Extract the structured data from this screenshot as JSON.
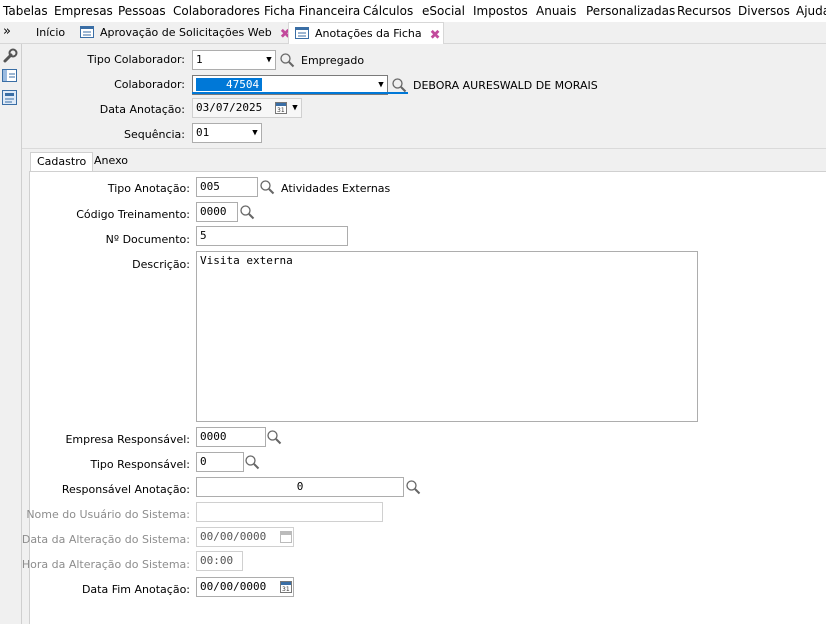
{
  "menu": [
    "Tabelas",
    "Empresas",
    "Pessoas",
    "Colaboradores",
    "Ficha Financeira",
    "Cálculos",
    "eSocial",
    "Impostos",
    "Anuais",
    "Personalizadas",
    "Recursos",
    "Diversos",
    "Ajuda"
  ],
  "tabs": {
    "chevron": "»",
    "inicio": "Início",
    "aprovacao": "Aprovação de Solicitações Web",
    "anotacoes": "Anotações da Ficha",
    "close_glyph": "✖"
  },
  "header": {
    "tipo_colaborador": {
      "label": "Tipo Colaborador:",
      "value": "1",
      "desc": "Empregado"
    },
    "colaborador": {
      "label": "Colaborador:",
      "value": "47504",
      "desc": "DEBORA AURESWALD DE MORAIS"
    },
    "data_anotacao": {
      "label": "Data Anotação:",
      "value": "03/07/2025"
    },
    "sequencia": {
      "label": "Sequência:",
      "value": "01"
    }
  },
  "content_tabs": {
    "cadastro": "Cadastro",
    "anexo": "Anexo"
  },
  "form": {
    "tipo_anotacao": {
      "label": "Tipo Anotação:",
      "value": "005",
      "desc": "Atividades Externas"
    },
    "codigo_treinamento": {
      "label": "Código Treinamento:",
      "value": "0000"
    },
    "numero_documento": {
      "label": "Nº Documento:",
      "value": "5"
    },
    "descricao": {
      "label": "Descrição:",
      "value": "Visita externa"
    },
    "empresa_responsavel": {
      "label": "Empresa Responsável:",
      "value": "0000"
    },
    "tipo_responsavel": {
      "label": "Tipo Responsável:",
      "value": "0"
    },
    "responsavel_anotacao": {
      "label": "Responsável Anotação:",
      "value": "0"
    },
    "nome_usuario": {
      "label": "Nome do Usuário do Sistema:",
      "value": ""
    },
    "data_alteracao": {
      "label": "Data da Alteração do Sistema:",
      "value": "00/00/0000"
    },
    "hora_alteracao": {
      "label": "Hora da Alteração do Sistema:",
      "value": "00:00"
    },
    "data_fim": {
      "label": "Data Fim Anotação:",
      "value": "00/00/0000"
    }
  },
  "glyphs": {
    "dropdown": "▼",
    "spin": "▼"
  },
  "colors": {
    "selection": "#0078d7",
    "tab_close": "#c24a9c",
    "disabled_text": "#8d8d8d"
  }
}
